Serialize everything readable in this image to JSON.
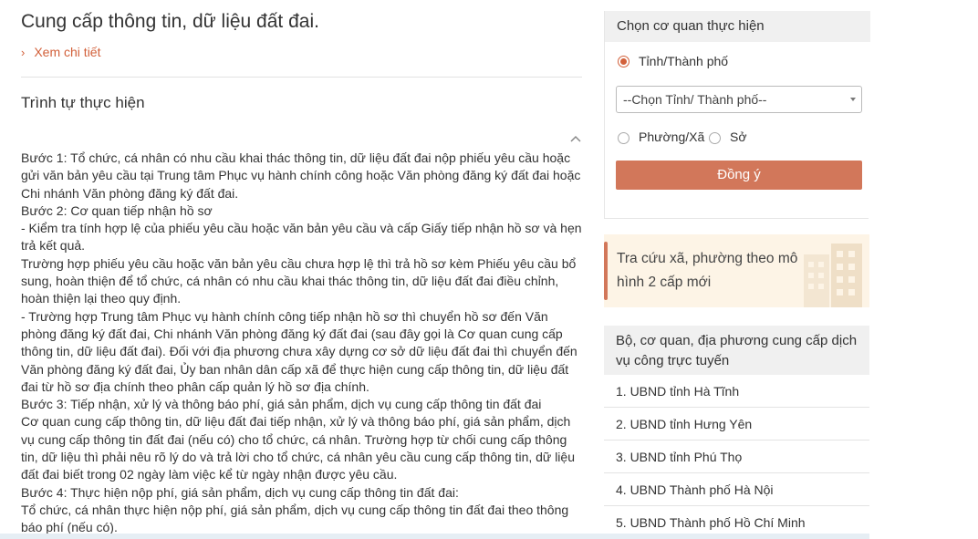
{
  "main": {
    "title": "Cung cấp thông tin, dữ liệu đất đai.",
    "detail_link": "Xem chi tiết",
    "section_title": "Trình tự thực hiện",
    "procedure_lines": [
      "Bước 1: Tổ chức, cá nhân có nhu cầu khai thác thông tin, dữ liệu đất đai nộp phiếu yêu cầu hoặc gửi văn bản yêu cầu tại Trung tâm Phục vụ hành chính công hoặc Văn phòng đăng ký đất đai hoặc Chi nhánh Văn phòng đăng ký đất đai.",
      "Bước 2: Cơ quan tiếp nhận hồ sơ",
      "- Kiểm tra tính hợp lệ của phiếu yêu cầu hoặc văn bản yêu cầu và cấp Giấy tiếp nhận hồ sơ và hẹn trả kết quả.",
      "Trường hợp phiếu yêu cầu hoặc văn bản yêu cầu chưa hợp lệ thì trả hồ sơ kèm Phiếu yêu cầu bổ sung, hoàn thiện để tổ chức, cá nhân có nhu cầu khai thác thông tin, dữ liệu đất đai điều chỉnh, hoàn thiện lại theo quy định.",
      "- Trường hợp Trung tâm Phục vụ hành chính công tiếp nhận hồ sơ thì chuyển hồ sơ đến Văn phòng đăng ký đất đai, Chi nhánh Văn phòng đăng ký đất đai (sau đây gọi là Cơ quan cung cấp thông tin, dữ liệu đất đai). Đối với địa phương chưa xây dựng cơ sở dữ liệu đất đai thì chuyển đến Văn phòng đăng ký đất đai, Ủy ban nhân dân cấp xã để thực hiện cung cấp thông tin, dữ liệu đất đai từ hồ sơ địa chính theo phân cấp quản lý hồ sơ địa chính.",
      "Bước 3: Tiếp nhận, xử lý và thông báo phí, giá sản phẩm, dịch vụ cung cấp thông tin đất đai",
      "Cơ quan cung cấp thông tin, dữ liệu đất đai tiếp nhận, xử lý và thông báo phí, giá sản phẩm, dịch vụ cung cấp thông tin đất đai (nếu có) cho tổ chức, cá nhân. Trường hợp từ chối cung cấp thông tin, dữ liệu thì phải nêu rõ lý do và trả lời cho tổ chức, cá nhân yêu cầu cung cấp thông tin, dữ liệu đất đai biết trong 02 ngày làm việc kể từ ngày nhận được yêu cầu.",
      "Bước 4: Thực hiện nộp phí, giá sản phẩm, dịch vụ cung cấp thông tin đất đai:",
      "Tổ chức, cá nhân thực hiện nộp phí, giá sản phẩm, dịch vụ cung cấp thông tin đất đai theo thông báo phí (nếu có)."
    ]
  },
  "agency_panel": {
    "heading": "Chọn cơ quan thực hiện",
    "radio_province": "Tỉnh/Thành phố",
    "select_value": "--Chọn Tỉnh/ Thành phố--",
    "radio_ward": "Phường/Xã",
    "radio_department": "Sở",
    "submit_label": "Đồng ý"
  },
  "banner": {
    "text": "Tra cứu xã, phường theo mô hình 2 cấp mới"
  },
  "providers": {
    "heading": "Bộ, cơ quan, địa phương cung cấp dịch vụ công trực tuyến",
    "items": [
      "1. UBND tỉnh Hà Tĩnh",
      "2. UBND tỉnh Hưng Yên",
      "3. UBND tỉnh Phú Thọ",
      "4. UBND Thành phố Hà Nội",
      "5. UBND Thành phố Hồ Chí Minh"
    ]
  },
  "colors": {
    "accent": "#d2603a",
    "button": "#d2775a",
    "panel_header": "#f0f0f0",
    "banner_bg": "#fdf4e6"
  }
}
